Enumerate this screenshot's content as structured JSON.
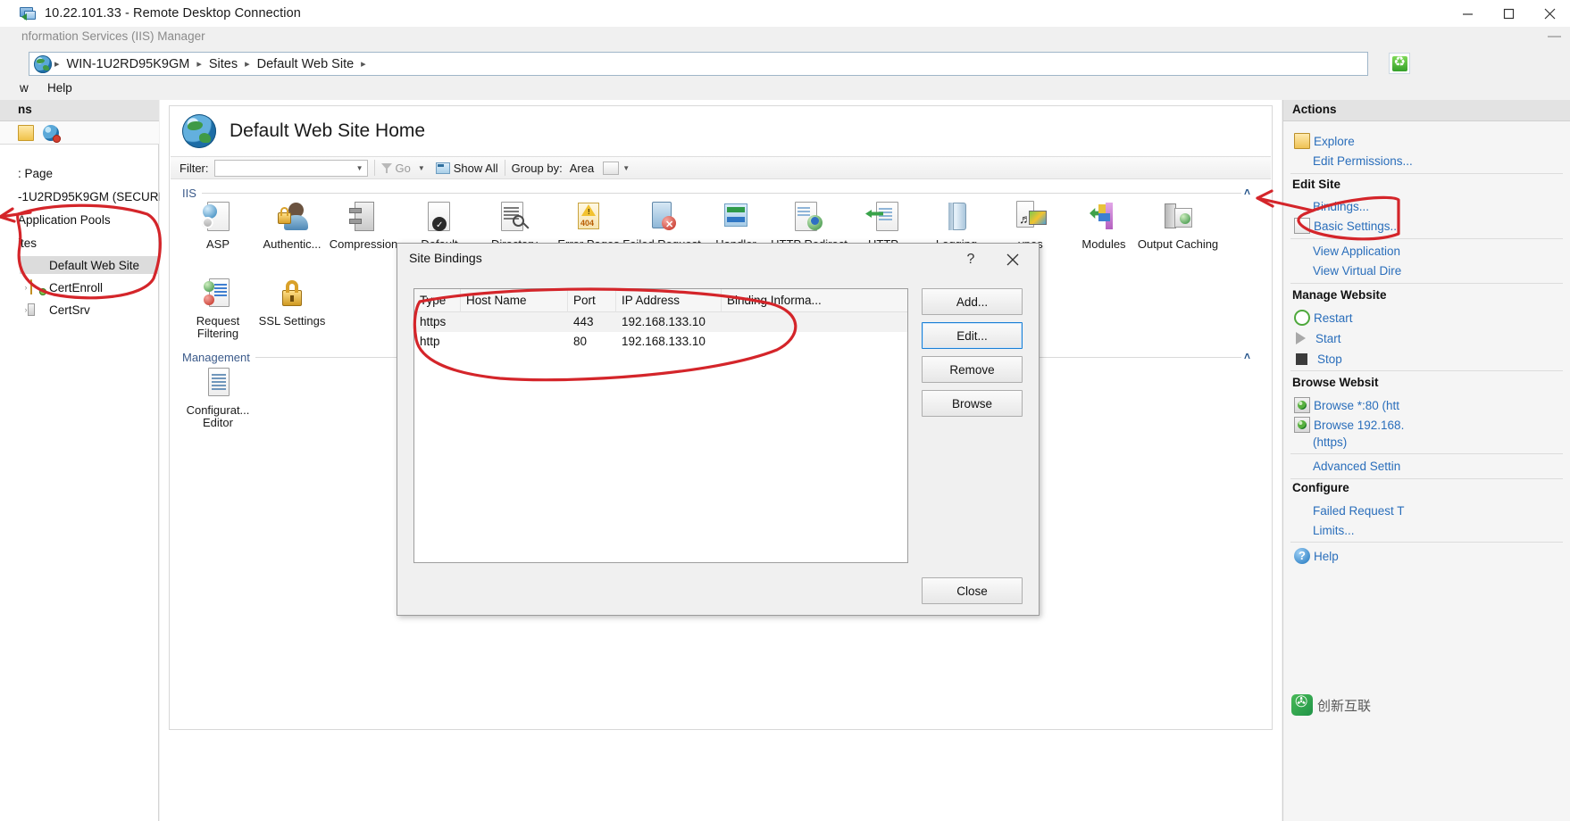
{
  "rdp": {
    "title": "10.22.101.33 - Remote Desktop Connection",
    "minimize": "minimize-icon",
    "maximize": "maximize-icon",
    "close": "close-icon"
  },
  "iis_window": {
    "title": "nformation Services (IIS) Manager",
    "minimize_glyph": "—"
  },
  "breadcrumb": {
    "items": [
      "WIN-1U2RD95K9GM",
      "Sites",
      "Default Web Site"
    ],
    "separator": "▸",
    "trailing_separator": "▸",
    "refresh_icon": "recycle-icon"
  },
  "menubar": {
    "items": [
      "w",
      "Help"
    ]
  },
  "tree": {
    "header": "ns",
    "toolbar_icons": [
      "page-icon",
      "globe-disconnect-icon"
    ],
    "items": [
      {
        "label": ": Page",
        "indent": 2,
        "arrow": "",
        "icon": "none",
        "selected": false
      },
      {
        "label": "-1U2RD95K9GM (SECURIT",
        "indent": 2,
        "arrow": "",
        "icon": "none",
        "selected": false
      },
      {
        "label": "Application Pools",
        "indent": 2,
        "arrow": "",
        "icon": "none",
        "selected": false
      },
      {
        "label": "ites",
        "indent": 2,
        "arrow": "",
        "icon": "none",
        "selected": false
      },
      {
        "label": "Default Web Site",
        "indent": 24,
        "arrow": "",
        "icon": "globe",
        "selected": true
      },
      {
        "label": "CertEnroll",
        "indent": 24,
        "arrow": "›",
        "icon": "folder",
        "selected": false
      },
      {
        "label": "CertSrv",
        "indent": 24,
        "arrow": "›",
        "icon": "app",
        "selected": false
      }
    ]
  },
  "content": {
    "page_title": "Default Web Site Home",
    "filter": {
      "label": "Filter:",
      "value": "",
      "placeholder": "",
      "go_label": "Go",
      "show_all_label": "Show All",
      "group_by_label": "Group by:",
      "group_by_value": "Area"
    },
    "sections": [
      {
        "name": "IIS",
        "chevron": "˄"
      },
      {
        "name": "Management",
        "chevron": "˄"
      }
    ],
    "iis_features": [
      {
        "label": "ASP",
        "icon": "asp-icon"
      },
      {
        "label": "Authentic...",
        "icon": "authentication-icon"
      },
      {
        "label": "Compression",
        "icon": "compression-icon"
      },
      {
        "label": "Default Document",
        "icon": "default-document-icon"
      },
      {
        "label": "Directory Browsing",
        "icon": "directory-browsing-icon"
      },
      {
        "label": "Error Pages",
        "icon": "error-pages-icon"
      },
      {
        "label": "Failed Request Tracing",
        "icon": "failed-request-icon"
      },
      {
        "label": "Handler Mappings",
        "icon": "handler-mappings-icon"
      },
      {
        "label": "HTTP Redirect",
        "icon": "http-redirect-icon"
      },
      {
        "label": "HTTP Response Headers",
        "icon": "http-response-headers-icon"
      },
      {
        "label": "Logging",
        "icon": "logging-icon"
      },
      {
        "label": "ypes",
        "icon": "mime-types-icon"
      },
      {
        "label": "Modules",
        "icon": "modules-icon"
      },
      {
        "label": "Output Caching",
        "icon": "output-caching-icon"
      }
    ],
    "iis_features_row2": [
      {
        "label": "Request Filtering",
        "icon": "request-filtering-icon"
      },
      {
        "label": "SSL Settings",
        "icon": "ssl-settings-icon"
      }
    ],
    "management_features": [
      {
        "label": "Configurat... Editor",
        "icon": "configuration-editor-icon"
      }
    ]
  },
  "actions": {
    "header": "Actions",
    "items": [
      {
        "label": "Explore",
        "icon": "explore-icon",
        "type": "link"
      },
      {
        "label": "Edit Permissions...",
        "icon": "none",
        "type": "link"
      },
      {
        "label": "Edit Site",
        "icon": "none",
        "type": "group"
      },
      {
        "label": "Bindings...",
        "icon": "none",
        "type": "link"
      },
      {
        "label": "Basic Settings...",
        "icon": "basic-settings-icon",
        "type": "link"
      },
      {
        "label": "View Application",
        "icon": "none",
        "type": "link"
      },
      {
        "label": "View Virtual Dire",
        "icon": "none",
        "type": "link"
      },
      {
        "label": "Manage Website",
        "icon": "none",
        "type": "group"
      },
      {
        "label": "Restart",
        "icon": "restart-icon",
        "type": "link"
      },
      {
        "label": "Start",
        "icon": "start-icon",
        "type": "link"
      },
      {
        "label": "Stop",
        "icon": "stop-icon",
        "type": "link"
      },
      {
        "label": "Browse Websit",
        "icon": "none",
        "type": "group"
      },
      {
        "label": "Browse *:80 (htt",
        "icon": "browse-icon",
        "type": "link"
      },
      {
        "label": "Browse 192.168.",
        "icon": "browse-icon",
        "type": "link"
      },
      {
        "label": "(https)",
        "icon": "none",
        "type": "cont"
      },
      {
        "label": "Advanced Settin",
        "icon": "none",
        "type": "link"
      },
      {
        "label": "Configure",
        "icon": "none",
        "type": "group"
      },
      {
        "label": "Failed Request T",
        "icon": "none",
        "type": "link"
      },
      {
        "label": "Limits...",
        "icon": "none",
        "type": "link"
      },
      {
        "label": "Help",
        "icon": "help-icon",
        "type": "link"
      }
    ]
  },
  "dialog": {
    "title": "Site Bindings",
    "help_glyph": "?",
    "close_glyph": "✕",
    "columns": [
      "Type",
      "Host Name",
      "Port",
      "IP Address",
      "Binding Informa..."
    ],
    "rows": [
      {
        "type": "https",
        "host_name": "",
        "port": "443",
        "ip_address": "192.168.133.10",
        "binding_information": ""
      },
      {
        "type": "http",
        "host_name": "",
        "port": "80",
        "ip_address": "192.168.133.10",
        "binding_information": ""
      }
    ],
    "buttons": {
      "add": "Add...",
      "edit": "Edit...",
      "remove": "Remove",
      "browse": "Browse",
      "close": "Close"
    },
    "focused_button": "Edit..."
  },
  "watermark": {
    "text": "创新互联"
  },
  "colors": {
    "link": "#2a6ebb",
    "annotation_red": "#d4252a",
    "section_label": "#3b5a8a",
    "selection": "#dcdcdc"
  }
}
